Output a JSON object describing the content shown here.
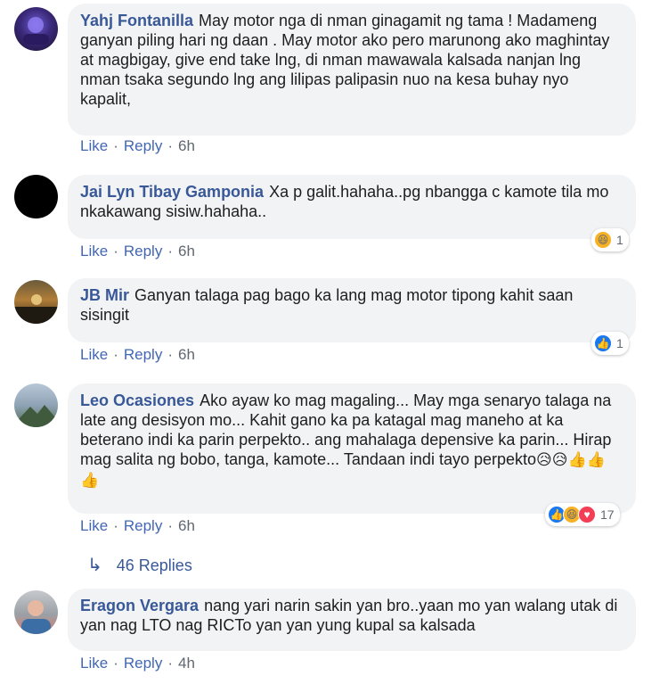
{
  "comments": [
    {
      "author": "Yahj Fontanilla",
      "text": "May motor nga di nman ginagamit ng tama ! Madameng ganyan piling hari ng daan . May motor ako pero marunong ako maghintay at magbigay, give end take lng, di nman mawawala kalsada nanjan lng nman tsaka segundo lng ang lilipas palipasin nuo na kesa buhay nyo kapalit,",
      "like": "Like",
      "reply": "Reply",
      "time": "6h"
    },
    {
      "author": "Jai Lyn Tibay Gamponia",
      "text": "Xa p galit.hahaha..pg nbangga c kamote tila mo nkakawang sisiw.hahaha..",
      "like": "Like",
      "reply": "Reply",
      "time": "6h",
      "reaction_count": "1",
      "reactions": [
        "haha"
      ]
    },
    {
      "author": "JB Mir",
      "text": "Ganyan talaga pag bago ka lang mag motor tipong kahit saan sisingit",
      "like": "Like",
      "reply": "Reply",
      "time": "6h",
      "reaction_count": "1",
      "reactions": [
        "like"
      ]
    },
    {
      "author": "Leo Ocasiones",
      "text": "Ako ayaw ko mag magaling... May mga senaryo talaga na late ang desisyon mo... Kahit gano ka pa katagal mag maneho at ka beterano indi ka parin perpekto.. ang mahalaga depensive ka parin... Hirap mag salita ng bobo, tanga, kamote... Tandaan indi tayo perpekto",
      "text_emojis": "😥😥👍👍👍",
      "like": "Like",
      "reply": "Reply",
      "time": "6h",
      "reaction_count": "17",
      "reactions": [
        "like",
        "haha",
        "love"
      ]
    },
    {
      "author": "Eragon Vergara",
      "text": "nang yari narin sakin yan bro..yaan mo yan walang utak di yan nag LTO nag RICTo yan yan yung kupal sa kalsada",
      "like": "Like",
      "reply": "Reply",
      "time": "4h"
    }
  ],
  "replies_link": "46 Replies",
  "colors": {
    "author": "#385898",
    "bubble": "#f2f3f5",
    "link": "#4267b2",
    "meta": "#606770"
  }
}
